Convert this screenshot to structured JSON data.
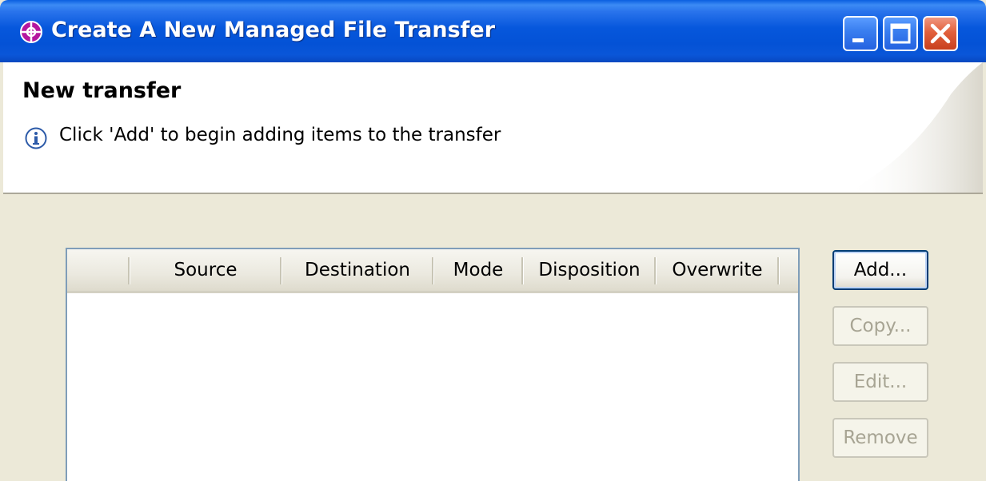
{
  "window": {
    "title": "Create A New Managed File Transfer",
    "app_icon": "purple-crosshair-icon",
    "controls": [
      "minimize-icon",
      "maximize-icon",
      "close-icon"
    ]
  },
  "banner": {
    "title": "New transfer",
    "info_icon": "info-icon",
    "message": "Click 'Add' to begin adding items to the transfer"
  },
  "table": {
    "columns": [
      "Source",
      "Destination",
      "Mode",
      "Disposition",
      "Overwrite"
    ],
    "rows": []
  },
  "buttons": {
    "add": "Add...",
    "copy": "Copy...",
    "edit": "Edit...",
    "remove": "Remove"
  },
  "colors": {
    "titlebar": "#0657dc",
    "close_button": "#e2603c",
    "dialog_background": "#ece9d8",
    "disabled_text": "#a7a493"
  }
}
